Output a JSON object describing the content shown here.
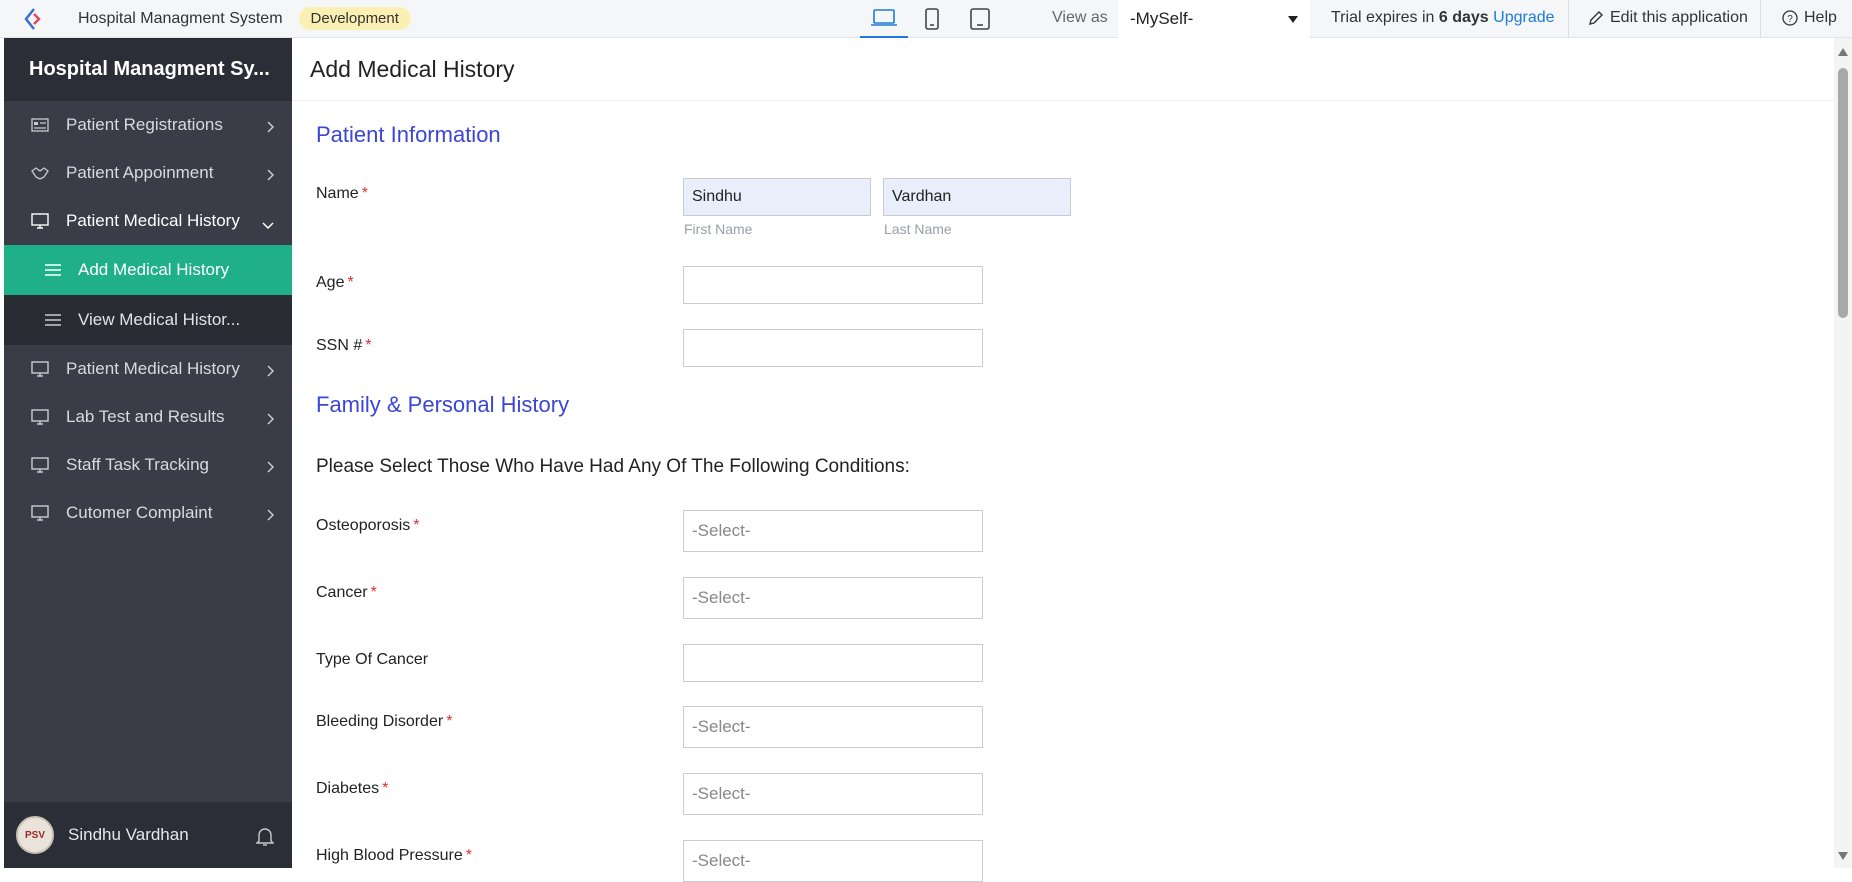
{
  "topbar": {
    "app_name": "Hospital Managment System",
    "environment": "Development",
    "view_as_label": "View as",
    "view_as_value": "-MySelf-",
    "trial_prefix": "Trial expires in ",
    "trial_days": "6 days",
    "upgrade": "Upgrade",
    "edit_app": "Edit this application",
    "help": "Help",
    "devices": [
      "laptop-icon",
      "phone-icon",
      "tablet-icon"
    ],
    "active_device": "laptop"
  },
  "sidebar": {
    "title": "Hospital Managment Sy...",
    "items": [
      {
        "label": "Patient Registrations",
        "icon": "form-icon"
      },
      {
        "label": "Patient Appoinment",
        "icon": "handshake-icon"
      },
      {
        "label": "Patient Medical History",
        "icon": "monitor-icon",
        "expanded": true
      },
      {
        "label": "Add Medical History",
        "icon": "list-icon",
        "sub": true,
        "active": true
      },
      {
        "label": "View Medical Histor...",
        "icon": "list-icon",
        "sub": true
      },
      {
        "label": "Patient Medical History",
        "icon": "monitor-icon"
      },
      {
        "label": "Lab Test and Results",
        "icon": "monitor-icon"
      },
      {
        "label": "Staff Task Tracking",
        "icon": "monitor-icon"
      },
      {
        "label": "Cutomer Complaint",
        "icon": "monitor-icon"
      }
    ],
    "user": {
      "name": "Sindhu Vardhan",
      "avatar_text": "PSV"
    }
  },
  "main": {
    "page_title": "Add Medical History",
    "section_patient": "Patient Information",
    "section_family": "Family & Personal History",
    "conditions_heading": "Please Select Those Who Have Had Any Of The Following Conditions:",
    "name_label": "Name",
    "first_name_value": "Sindhu",
    "last_name_value": "Vardhan",
    "first_name_caption": "First Name",
    "last_name_caption": "Last Name",
    "age_label": "Age",
    "ssn_label": "SSN #",
    "osteoporosis_label": "Osteoporosis",
    "cancer_label": "Cancer",
    "type_of_cancer_label": "Type Of Cancer",
    "bleeding_label": "Bleeding Disorder",
    "diabetes_label": "Diabetes",
    "hbp_label": "High Blood Pressure",
    "select_placeholder": "-Select-",
    "required_mark": "*"
  },
  "colors": {
    "sidebar_bg": "#3a3c47",
    "active_item": "#1fb089",
    "section_title": "#3b45d6",
    "link": "#1e7bd8",
    "env_badge": "#fbf0b4"
  }
}
